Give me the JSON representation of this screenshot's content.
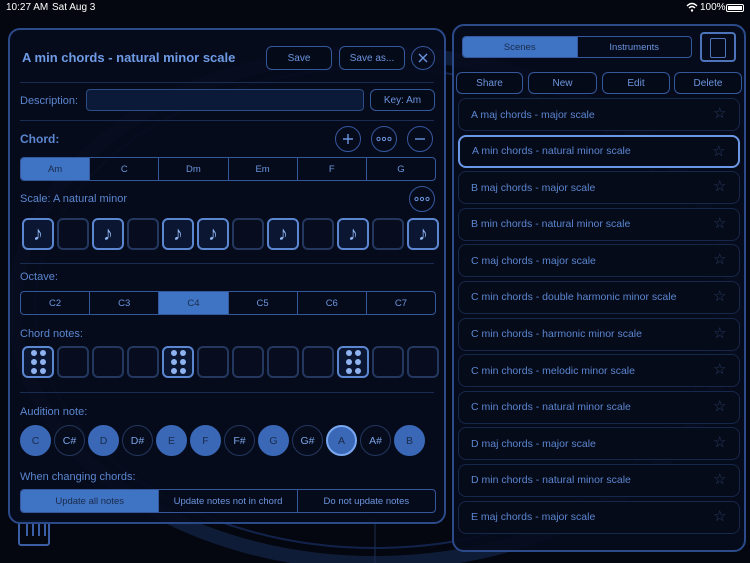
{
  "status": {
    "time": "10:27 AM",
    "date": "Sat Aug 3",
    "battery": "100%"
  },
  "editor": {
    "title": "A min chords  - natural minor scale",
    "save_label": "Save",
    "save_as_label": "Save as...",
    "description_label": "Description:",
    "description_value": "",
    "key_label": "Key: Am",
    "chord_label": "Chord:",
    "chords": [
      "Am",
      "C",
      "Dm",
      "Em",
      "F",
      "G"
    ],
    "selected_chord": "Am",
    "scale_label": "Scale: A natural minor",
    "scale_cells": [
      1,
      0,
      1,
      0,
      1,
      1,
      0,
      1,
      0,
      1,
      0,
      1
    ],
    "octave_label": "Octave:",
    "octaves": [
      "C2",
      "C3",
      "C4",
      "C5",
      "C6",
      "C7"
    ],
    "selected_octave": "C4",
    "chord_notes_label": "Chord notes:",
    "chord_note_cells": [
      1,
      0,
      0,
      0,
      1,
      0,
      0,
      0,
      0,
      1,
      0,
      0
    ],
    "audition_label": "Audition note:",
    "audition_notes": [
      "C",
      "C#",
      "D",
      "D#",
      "E",
      "F",
      "F#",
      "G",
      "G#",
      "A",
      "A#",
      "B"
    ],
    "audition_filled": [
      1,
      0,
      1,
      0,
      1,
      1,
      0,
      1,
      0,
      1,
      0,
      1
    ],
    "audition_current": "A",
    "changing_label": "When changing chords:",
    "changing_options": [
      "Update all notes",
      "Update notes not in chord",
      "Do not update notes"
    ],
    "changing_selected": "Update all notes"
  },
  "library": {
    "tabs": [
      "Scenes",
      "Instruments"
    ],
    "selected_tab": "Scenes",
    "actions": [
      "Share",
      "New",
      "Edit",
      "Delete"
    ],
    "items": [
      "A maj chords  - major scale",
      "A min chords  - natural minor scale",
      "B maj chords  - major scale",
      "B min chords  - natural minor scale",
      "C maj chords  - major scale",
      "C min chords  - double harmonic minor scale",
      "C min chords  - harmonic minor scale",
      "C min chords  - melodic minor scale",
      "C min chords  - natural minor scale",
      "D maj chords  - major scale",
      "D min chords  - natural minor scale",
      "E maj chords  - major scale"
    ],
    "selected_item": "A min chords  - natural minor scale"
  },
  "colors": {
    "accent": "#3f74c4",
    "text": "#5b86d0",
    "background": "#04070f"
  }
}
